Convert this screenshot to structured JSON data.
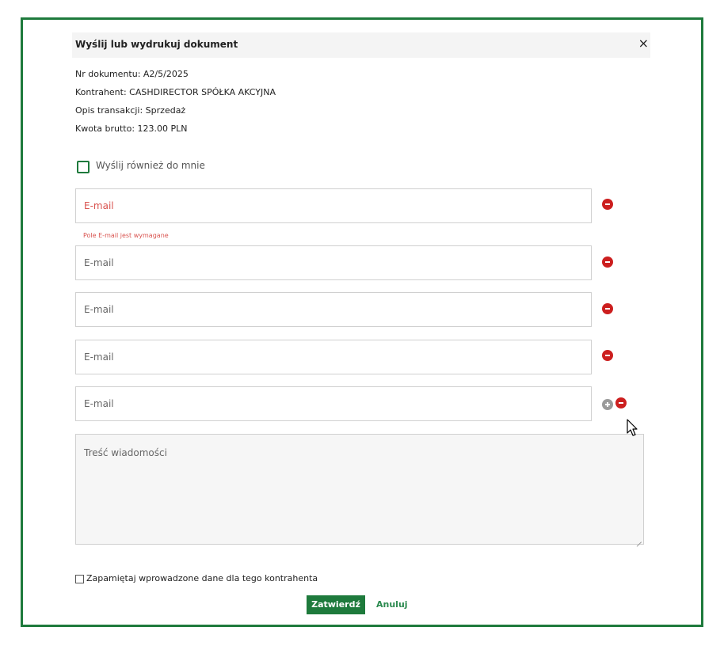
{
  "dialog": {
    "title": "Wyślij lub wydrukuj dokument",
    "close_glyph": "×"
  },
  "info": {
    "doc_number": "Nr dokumentu: A2/5/2025",
    "contractor": "Kontrahent: CASHDIRECTOR SPÓŁKA AKCYJNA",
    "description": "Opis transakcji: Sprzedaż",
    "amount": "Kwota brutto: 123.00 PLN"
  },
  "send_to_me": {
    "label": "Wyślij również do mnie",
    "checked": false
  },
  "email_fields": [
    {
      "placeholder": "E-mail",
      "value": "",
      "error": true
    },
    {
      "placeholder": "E-mail",
      "value": "",
      "error": false
    },
    {
      "placeholder": "E-mail",
      "value": "",
      "error": false
    },
    {
      "placeholder": "E-mail",
      "value": "",
      "error": false
    },
    {
      "placeholder": "E-mail",
      "value": "",
      "error": false
    }
  ],
  "email_error_message": "Pole E-mail jest wymagane",
  "message": {
    "placeholder": "Treść wiadomości",
    "value": ""
  },
  "remember": {
    "label": "Zapamiętaj wprowadzone dane dla tego kontrahenta",
    "checked": false
  },
  "actions": {
    "confirm_label": "Zatwierdź",
    "cancel_label": "Anuluj"
  },
  "icons": {
    "remove": "minus-circle-icon",
    "add": "plus-circle-icon",
    "cursor": "mouse-pointer-icon"
  },
  "colors": {
    "brand_green": "#1e7a3c",
    "error_red": "#d9534f",
    "remove_red": "#cc1f1f",
    "add_gray": "#9a9a9a"
  }
}
